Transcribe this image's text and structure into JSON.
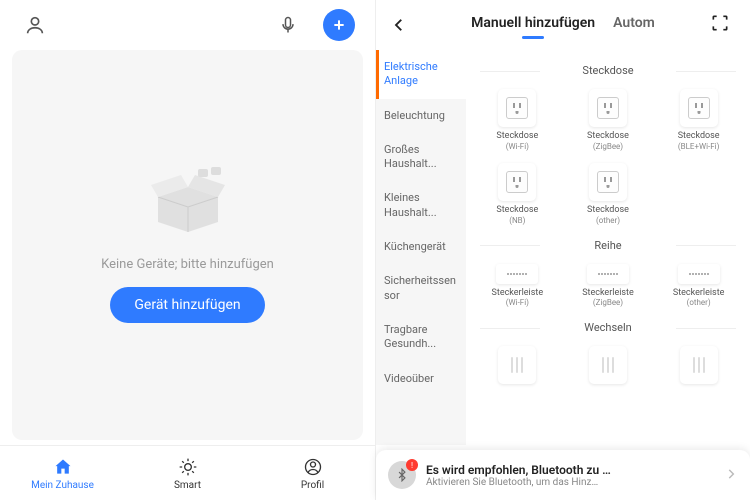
{
  "left": {
    "empty_text": "Keine Geräte; bitte hinzufügen",
    "add_button": "Gerät hinzufügen",
    "tabs": [
      {
        "label": "Mein Zuhause"
      },
      {
        "label": "Smart"
      },
      {
        "label": "Profil"
      }
    ]
  },
  "right": {
    "header_tabs": {
      "manual": "Manuell hinzufügen",
      "auto": "Autom"
    },
    "categories": [
      "Elektrische Anlage",
      "Beleuchtung",
      "Großes Haushalt...",
      "Kleines Haushalt...",
      "Küchengerät",
      "Sicherheitssensor",
      "Tragbare Gesundh...",
      "Videoüber"
    ],
    "sections": {
      "steckdose": {
        "title": "Steckdose",
        "items": [
          {
            "name": "Steckdose",
            "sub": "(Wi-Fi)"
          },
          {
            "name": "Steckdose",
            "sub": "(ZigBee)"
          },
          {
            "name": "Steckdose",
            "sub": "(BLE+Wi-Fi)"
          },
          {
            "name": "Steckdose",
            "sub": "(NB)"
          },
          {
            "name": "Steckdose",
            "sub": "(other)"
          }
        ]
      },
      "reihe": {
        "title": "Reihe",
        "items": [
          {
            "name": "Steckerleiste",
            "sub": "(Wi-Fi)"
          },
          {
            "name": "Steckerleiste",
            "sub": "(ZigBee)"
          },
          {
            "name": "Steckerleiste",
            "sub": "(other)"
          }
        ]
      },
      "wechseln": {
        "title": "Wechseln"
      }
    },
    "notice": {
      "title": "Es wird empfohlen, Bluetooth zu …",
      "subtitle": "Aktivieren Sie Bluetooth, um das Hinz…"
    }
  }
}
